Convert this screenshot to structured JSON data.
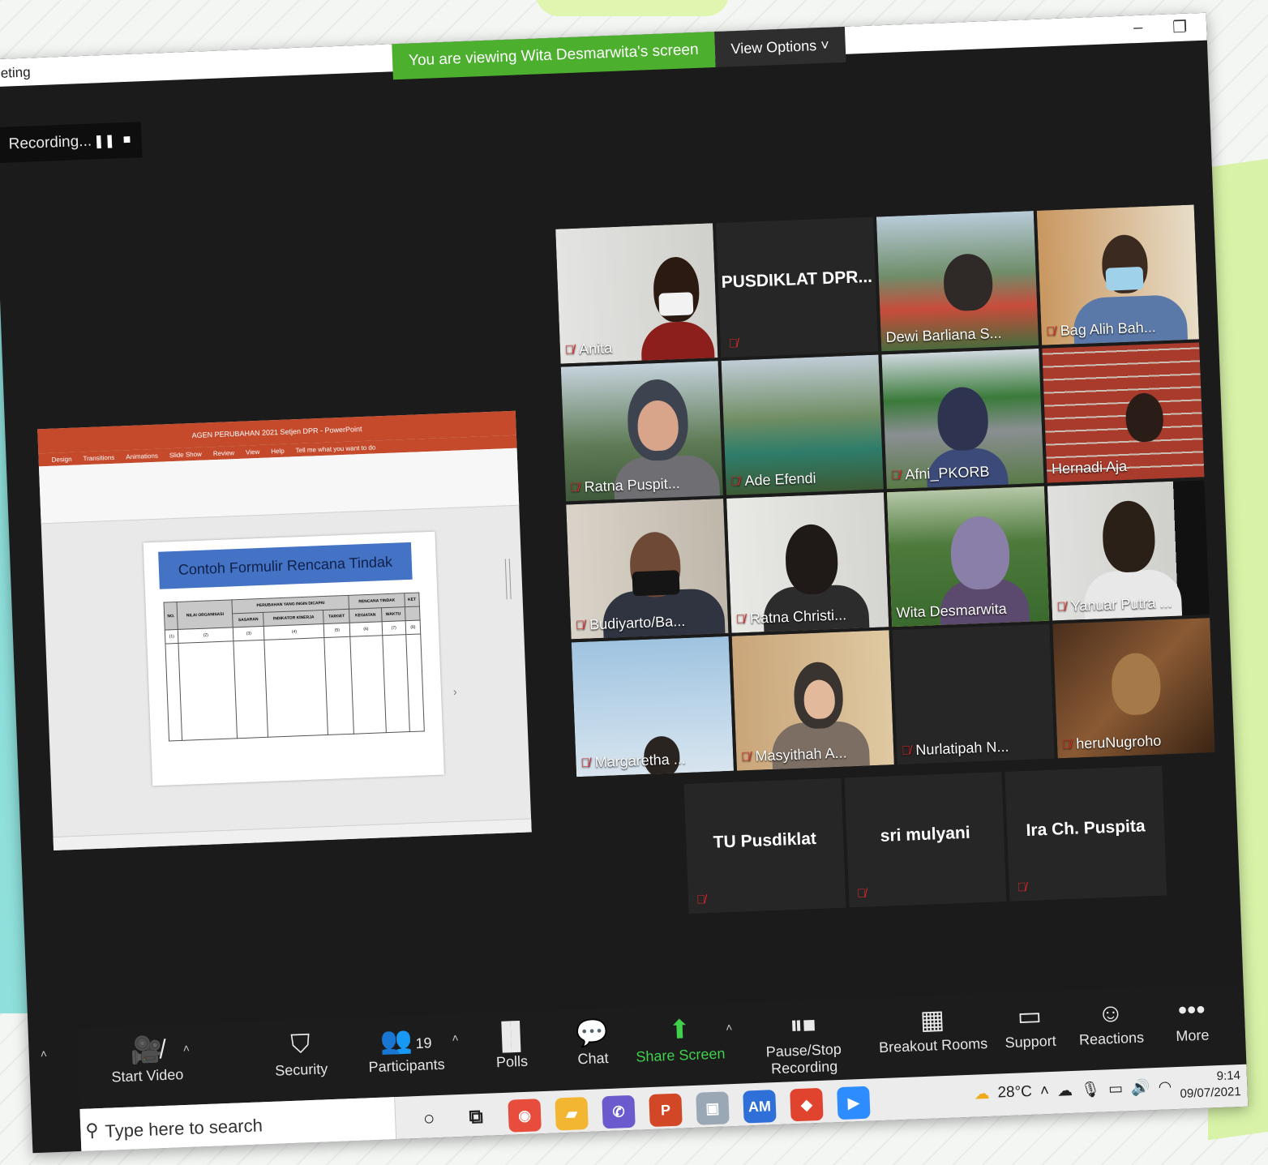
{
  "window": {
    "title": "eeting",
    "minimize_icon": "minimize-icon",
    "restore_icon": "restore-icon"
  },
  "share_banner": {
    "viewing_text": "You are viewing Wita Desmarwita's screen",
    "view_options_label": "View Options"
  },
  "recording": {
    "label": "Recording...",
    "pause_icon": "pause-icon",
    "stop_icon": "stop-icon"
  },
  "shared_screen": {
    "app_title": "AGEN PERUBAHAN 2021 Setjen DPR - PowerPoint",
    "menu_tabs": [
      "Design",
      "Transitions",
      "Animations",
      "Slide Show",
      "Review",
      "View",
      "Help",
      "Tell me what you want to do"
    ],
    "slide_title": "Contoh Formulir Rencana Tindak",
    "table_header_row1": [
      "NO.",
      "NILAI ORGANISASI",
      "PERUBAHAN YANG INGIN DICAPAI",
      "RENCANA TINDAK",
      "KET"
    ],
    "table_header_row2": [
      "SASARAN",
      "INDIKATOR KINERJA",
      "TARGET",
      "KEGIATAN",
      "WAKTU"
    ],
    "table_numbers": [
      "(1)",
      "(2)",
      "(3)",
      "(4)",
      "(5)",
      "(6)",
      "(7)",
      "(8)"
    ]
  },
  "participants": [
    {
      "name": "Anita",
      "video": true
    },
    {
      "name": "PUSDIKLAT DPR...",
      "video": false
    },
    {
      "name": "Dewi Barliana S...",
      "video": true
    },
    {
      "name": "Bag Alih Bah...",
      "video": true
    },
    {
      "name": "Ratna Puspit...",
      "video": true
    },
    {
      "name": "Ade Efendi",
      "video": true
    },
    {
      "name": "Afni_PKORB",
      "video": true
    },
    {
      "name": "Hernadi Aja",
      "video": true
    },
    {
      "name": "Budiyarto/Ba...",
      "video": true
    },
    {
      "name": "Ratna Christi...",
      "video": true
    },
    {
      "name": "Wita Desmarwita",
      "video": true,
      "active_speaker": true
    },
    {
      "name": "Yanuar Putra ...",
      "video": true
    },
    {
      "name": "Margaretha ...",
      "video": true
    },
    {
      "name": "Masyithah A...",
      "video": true
    },
    {
      "name": "Nurlatipah N...",
      "video": false
    },
    {
      "name": "heruNugroho",
      "video": true
    },
    {
      "name": "TU Pusdiklat",
      "video": false
    },
    {
      "name": "sri mulyani",
      "video": false
    },
    {
      "name": "Ira Ch. Puspita",
      "video": false
    }
  ],
  "toolbar": {
    "start_video": "Start Video",
    "security": "Security",
    "participants": "Participants",
    "participants_count": "19",
    "polls": "Polls",
    "chat": "Chat",
    "share_screen": "Share Screen",
    "pause_stop_recording": "Pause/Stop Recording",
    "breakout_rooms": "Breakout Rooms",
    "support": "Support",
    "reactions": "Reactions",
    "more": "More",
    "accent_green": "#3fd14b"
  },
  "taskbar": {
    "search_placeholder": "Type here to search",
    "app_am_label": "AM",
    "temperature": "28°C",
    "time": "9:14",
    "date": "09/07/2021"
  }
}
